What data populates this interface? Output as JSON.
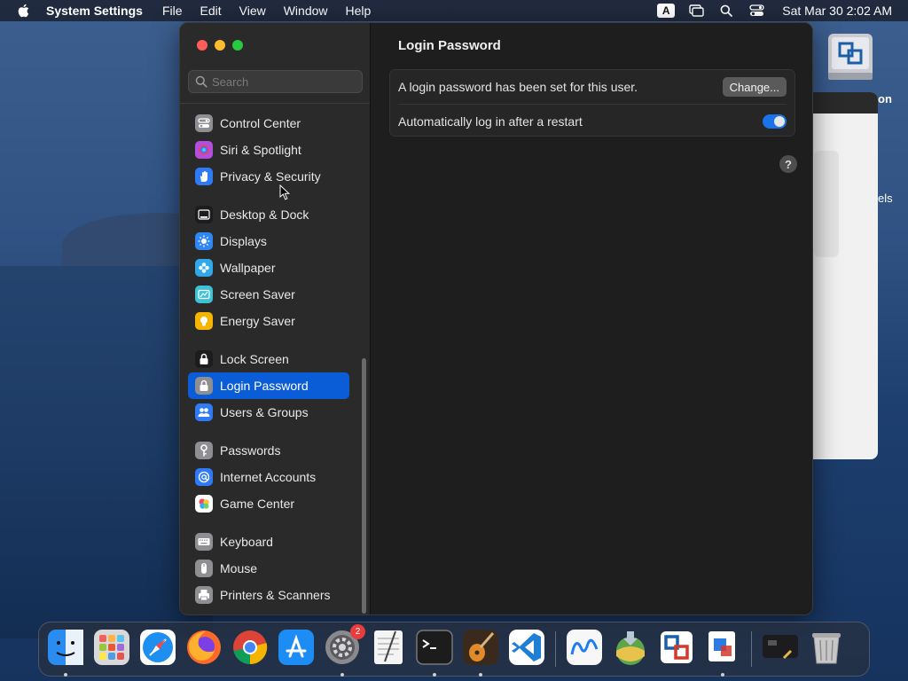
{
  "menubar": {
    "app_name": "System Settings",
    "menus": [
      "File",
      "Edit",
      "View",
      "Window",
      "Help"
    ],
    "input_source": "A",
    "clock": "Sat Mar 30  2:02 AM"
  },
  "background_window": {
    "text_top": "on",
    "text_mid": "els"
  },
  "sidebar": {
    "search_placeholder": "Search",
    "groups": [
      [
        {
          "label": "Control Center",
          "icon": "control-center-icon",
          "color": "#8e8e93"
        },
        {
          "label": "Siri & Spotlight",
          "icon": "siri-icon",
          "color": "#b34fe0"
        },
        {
          "label": "Privacy & Security",
          "icon": "hand-icon",
          "color": "#2f7bf6"
        }
      ],
      [
        {
          "label": "Desktop & Dock",
          "icon": "dock-icon",
          "color": "#1c1c1e"
        },
        {
          "label": "Displays",
          "icon": "sun-icon",
          "color": "#2f86f6"
        },
        {
          "label": "Wallpaper",
          "icon": "flower-icon",
          "color": "#31a8e8"
        },
        {
          "label": "Screen Saver",
          "icon": "screen-saver-icon",
          "color": "#3fc1d6"
        },
        {
          "label": "Energy Saver",
          "icon": "bulb-icon",
          "color": "#f4b400"
        }
      ],
      [
        {
          "label": "Lock Screen",
          "icon": "lock-icon",
          "color": "#1c1c1e"
        },
        {
          "label": "Login Password",
          "icon": "lock-icon",
          "color": "#8e8e93",
          "active": true
        },
        {
          "label": "Users & Groups",
          "icon": "users-icon",
          "color": "#2f7bf6"
        }
      ],
      [
        {
          "label": "Passwords",
          "icon": "key-icon",
          "color": "#8e8e93"
        },
        {
          "label": "Internet Accounts",
          "icon": "at-icon",
          "color": "#2f7bf6"
        },
        {
          "label": "Game Center",
          "icon": "game-center-icon",
          "color": "#ffffff"
        }
      ],
      [
        {
          "label": "Keyboard",
          "icon": "keyboard-icon",
          "color": "#8e8e93"
        },
        {
          "label": "Mouse",
          "icon": "mouse-icon",
          "color": "#8e8e93"
        },
        {
          "label": "Printers & Scanners",
          "icon": "printer-icon",
          "color": "#8e8e93"
        }
      ]
    ]
  },
  "main": {
    "title": "Login Password",
    "password_row_label": "A login password has been set for this user.",
    "change_button": "Change...",
    "autologin_label": "Automatically log in after a restart",
    "autologin_enabled": true,
    "help_label": "?"
  },
  "dock": {
    "items": [
      {
        "name": "Finder",
        "icon": "finder-icon",
        "color": "#2a8cf0",
        "running": true
      },
      {
        "name": "Launchpad",
        "icon": "launchpad-icon",
        "color": "#d8d8d8",
        "running": false
      },
      {
        "name": "Safari",
        "icon": "safari-icon",
        "color": "#1f8ef1",
        "running": false
      },
      {
        "name": "Firefox",
        "icon": "firefox-icon",
        "color": "#ff6a2b",
        "running": false
      },
      {
        "name": "Chrome",
        "icon": "chrome-icon",
        "color": "#e8e8e8",
        "running": false
      },
      {
        "name": "App Store",
        "icon": "app-store-icon",
        "color": "#1d8cf5",
        "running": false
      },
      {
        "name": "System Settings",
        "icon": "gear-icon",
        "color": "#8a8a8e",
        "running": true,
        "badge": "2"
      },
      {
        "name": "TextEdit",
        "icon": "textedit-icon",
        "color": "#f4f4f4",
        "running": false
      },
      {
        "name": "Terminal",
        "icon": "terminal-icon",
        "color": "#1c1c1c",
        "running": true
      },
      {
        "name": "GarageBand",
        "icon": "guitar-icon",
        "color": "#3a2a1e",
        "running": true
      },
      {
        "name": "VS Code",
        "icon": "vscode-icon",
        "color": "#ffffff",
        "running": false
      },
      {
        "name": "Freeform",
        "icon": "freeform-icon",
        "color": "#f7f7f7",
        "running": false
      },
      {
        "name": "macOS Installer",
        "icon": "installer-icon",
        "color": "#5da44b",
        "running": false
      },
      {
        "name": "Migration",
        "icon": "migration-icon",
        "color": "#ffffff",
        "running": false
      },
      {
        "name": "Network Utility",
        "icon": "network-icon",
        "color": "#ffffff",
        "running": true
      },
      {
        "name": "Screenshot",
        "icon": "screenshot-icon",
        "color": "#1c1c1e",
        "running": false
      },
      {
        "name": "Trash",
        "icon": "trash-icon",
        "color": "#c7c7c7",
        "running": false
      }
    ]
  }
}
